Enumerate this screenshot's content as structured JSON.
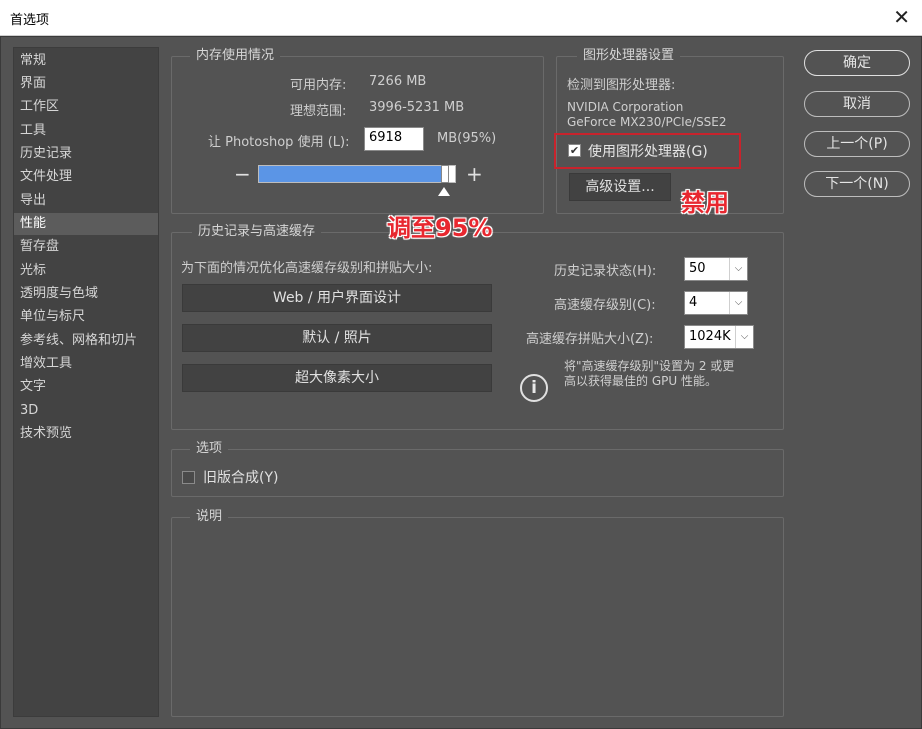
{
  "window": {
    "title": "首选项",
    "close_glyph": "✕"
  },
  "sidebar": {
    "items": [
      "常规",
      "界面",
      "工作区",
      "工具",
      "历史记录",
      "文件处理",
      "导出",
      "性能",
      "暂存盘",
      "光标",
      "透明度与色域",
      "单位与标尺",
      "参考线、网格和切片",
      "增效工具",
      "文字",
      "3D",
      "技术预览"
    ],
    "active_index": 7
  },
  "memory": {
    "title": "内存使用情况",
    "available_label": "可用内存:",
    "available_value": "7266 MB",
    "ideal_label": "理想范围:",
    "ideal_value": "3996-5231 MB",
    "use_label": "让 Photoshop 使用 (L):",
    "use_value": "6918",
    "use_unit": "MB(95%)",
    "slider_percent": 95,
    "minus": "−",
    "plus": "+"
  },
  "gpu": {
    "title": "图形处理器设置",
    "detected_label": "检测到图形处理器:",
    "vendor": "NVIDIA Corporation",
    "model": "GeForce MX230/PCIe/SSE2",
    "use_gpu_label": "使用图形处理器(G)",
    "use_gpu_checked": true,
    "check_glyph": "✔",
    "advanced_button": "高级设置..."
  },
  "history_cache": {
    "title": "历史记录与高速缓存",
    "optimize_label": "为下面的情况优化高速缓存级别和拼贴大小:",
    "buttons": [
      "Web / 用户界面设计",
      "默认 / 照片",
      "超大像素大小"
    ],
    "history_states_label": "历史记录状态(H):",
    "history_states_value": "50",
    "cache_levels_label": "高速缓存级别(C):",
    "cache_levels_value": "4",
    "tile_size_label": "高速缓存拼贴大小(Z):",
    "tile_size_value": "1024K",
    "dropdown_glyph": "⌵",
    "info_glyph": "i",
    "tip_line1": "将\"高速缓存级别\"设置为 2 或更",
    "tip_line2": "高以获得最佳的 GPU 性能。"
  },
  "options": {
    "title": "选项",
    "legacy_compositing_label": "旧版合成(Y)",
    "legacy_compositing_checked": false
  },
  "description": {
    "title": "说明"
  },
  "actions": {
    "ok": "确定",
    "cancel": "取消",
    "prev": "上一个(P)",
    "next": "下一个(N)"
  },
  "annotations": {
    "slider_note": "调至95%",
    "gpu_note": "禁用",
    "color": "#e8272f"
  }
}
